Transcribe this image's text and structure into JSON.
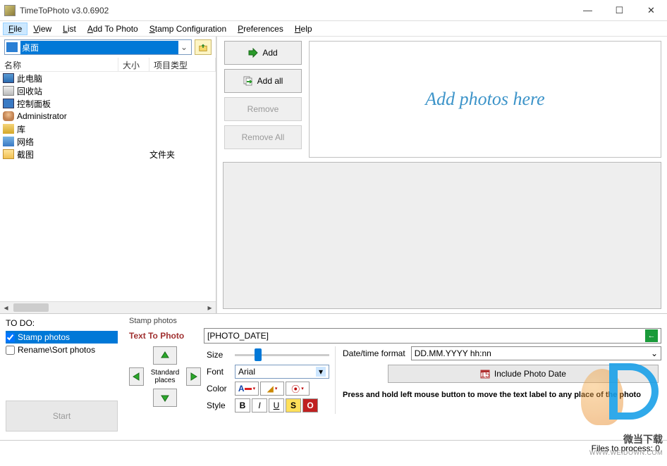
{
  "title": "TimeToPhoto v3.0.6902",
  "menu": {
    "file": "File",
    "view": "View",
    "list": "List",
    "addtophoto": "Add To Photo",
    "stampconfig": "Stamp Configuration",
    "preferences": "Preferences",
    "help": "Help"
  },
  "location": {
    "value": "桌面"
  },
  "fileheaders": {
    "name": "名称",
    "size": "大小",
    "type": "项目类型"
  },
  "files": [
    {
      "icon": "ico-monitor",
      "name": "此电脑",
      "type": ""
    },
    {
      "icon": "ico-recycle",
      "name": "回收站",
      "type": ""
    },
    {
      "icon": "ico-panel",
      "name": "控制面板",
      "type": ""
    },
    {
      "icon": "ico-user",
      "name": "Administrator",
      "type": ""
    },
    {
      "icon": "ico-lib",
      "name": "库",
      "type": ""
    },
    {
      "icon": "ico-net",
      "name": "网络",
      "type": ""
    },
    {
      "icon": "ico-folder",
      "name": "截图",
      "type": "文件夹"
    }
  ],
  "actions": {
    "add": "Add",
    "addall": "Add all",
    "remove": "Remove",
    "removeall": "Remove All"
  },
  "dropMessage": "Add photos here",
  "todo": {
    "header": "TO DO:",
    "stamp": "Stamp photos",
    "rename": "Rename\\Sort photos",
    "start": "Start"
  },
  "stamp": {
    "header": "Stamp photos",
    "textToPhoto": "Text To Photo",
    "textValue": "[PHOTO_DATE]",
    "standardPlaces": "Standard places",
    "size": "Size",
    "font": "Font",
    "fontValue": "Arial",
    "color": "Color",
    "style": "Style",
    "dtFormat": "Date/time format",
    "dtValue": "DD.MM.YYYY hh:nn",
    "includeDate": "Include Photo Date",
    "hint": "Press and hold left mouse button to move the text label to any place of the photo"
  },
  "status": {
    "files": "Files to process: 0"
  },
  "watermark": {
    "text": "微当下载",
    "url": "WWW.WEIDOWN.COM"
  }
}
